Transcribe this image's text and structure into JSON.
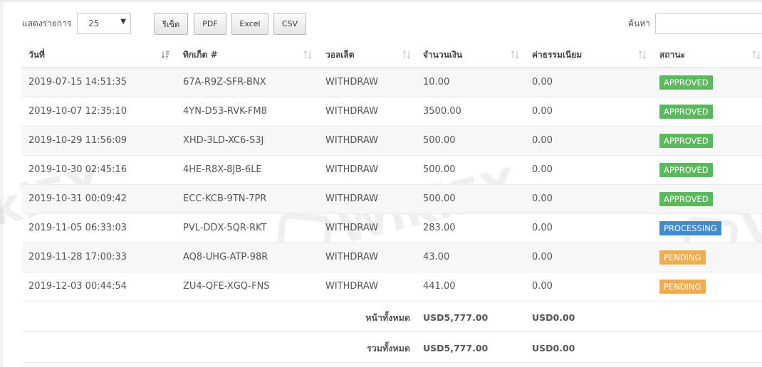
{
  "controls": {
    "length_label": "แสดงรายการ",
    "length_value": "25",
    "buttons": {
      "reset": "รีเซ็ต",
      "pdf": "PDF",
      "excel": "Excel",
      "csv": "CSV"
    },
    "search_label": "ค้นหา",
    "search_value": ""
  },
  "table": {
    "columns": [
      "วันที่",
      "ทิกเก็ต #",
      "วอลเล็ต",
      "จำนวนเงิน",
      "ค่าธรรมเนียม",
      "สถานะ"
    ],
    "rows": [
      {
        "date": "2019-07-15 14:51:35",
        "ticket": "67A-R9Z-SFR-BNX",
        "wallet": "WITHDRAW",
        "amount": "10.00",
        "fee": "0.00",
        "status": "APPROVED"
      },
      {
        "date": "2019-10-07 12:35:10",
        "ticket": "4YN-D53-RVK-FM8",
        "wallet": "WITHDRAW",
        "amount": "3500.00",
        "fee": "0.00",
        "status": "APPROVED"
      },
      {
        "date": "2019-10-29 11:56:09",
        "ticket": "XHD-3LD-XC6-S3J",
        "wallet": "WITHDRAW",
        "amount": "500.00",
        "fee": "0.00",
        "status": "APPROVED"
      },
      {
        "date": "2019-10-30 02:45:16",
        "ticket": "4HE-R8X-8JB-6LE",
        "wallet": "WITHDRAW",
        "amount": "500.00",
        "fee": "0.00",
        "status": "APPROVED"
      },
      {
        "date": "2019-10-31 00:09:42",
        "ticket": "ECC-KCB-9TN-7PR",
        "wallet": "WITHDRAW",
        "amount": "500.00",
        "fee": "0.00",
        "status": "APPROVED"
      },
      {
        "date": "2019-11-05 06:33:03",
        "ticket": "PVL-DDX-5QR-RKT",
        "wallet": "WITHDRAW",
        "amount": "283.00",
        "fee": "0.00",
        "status": "PROCESSING"
      },
      {
        "date": "2019-11-28 17:00:33",
        "ticket": "AQ8-UHG-ATP-98R",
        "wallet": "WITHDRAW",
        "amount": "43.00",
        "fee": "0.00",
        "status": "PENDING"
      },
      {
        "date": "2019-12-03 00:44:54",
        "ticket": "ZU4-QFE-XGQ-FNS",
        "wallet": "WITHDRAW",
        "amount": "441.00",
        "fee": "0.00",
        "status": "PENDING"
      }
    ],
    "footer": [
      {
        "label": "หน้าทั้งหมด",
        "amount": "USD5,777.00",
        "fee": "USD0.00"
      },
      {
        "label": "รวมทั้งหมด",
        "amount": "USD5,777.00",
        "fee": "USD0.00"
      }
    ]
  },
  "status_colors": {
    "APPROVED": "#5cb85c",
    "PROCESSING": "#428bca",
    "PENDING": "#f0ad4e"
  },
  "watermark": {
    "text": "WikiFX"
  },
  "icons": {
    "sort_active": "sort-amount-down-icon",
    "sort_both": "sort-both-icon"
  }
}
